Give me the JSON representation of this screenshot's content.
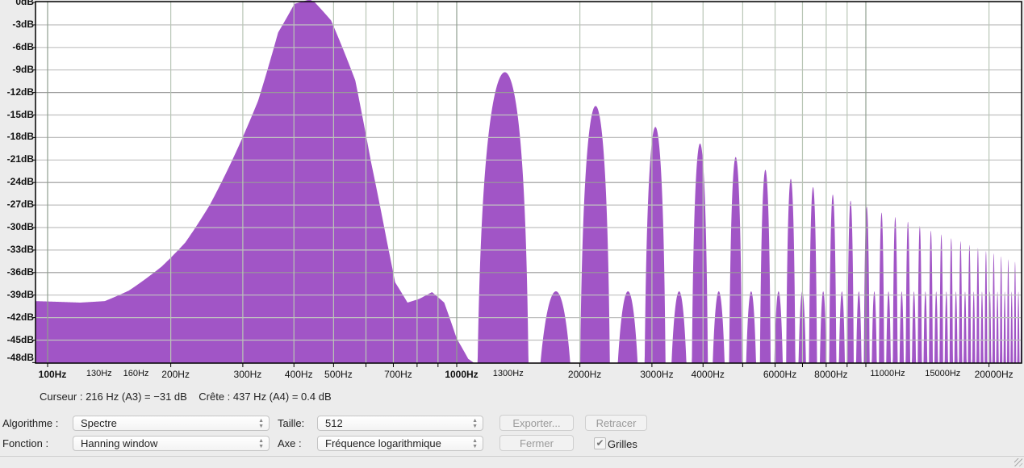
{
  "chart_data": {
    "type": "area",
    "title": "",
    "xlabel": "",
    "ylabel": "",
    "x_scale": "log",
    "xlim": [
      93,
      24000
    ],
    "ylim": [
      -48,
      0
    ],
    "grid": true,
    "fill_color": "#a155c6",
    "y_ticks": [
      {
        "v": 0,
        "label": "0dB"
      },
      {
        "v": -3,
        "label": "-3dB"
      },
      {
        "v": -6,
        "label": "-6dB"
      },
      {
        "v": -9,
        "label": "-9dB"
      },
      {
        "v": -12,
        "label": "-12dB"
      },
      {
        "v": -15,
        "label": "-15dB"
      },
      {
        "v": -18,
        "label": "-18dB"
      },
      {
        "v": -21,
        "label": "-21dB"
      },
      {
        "v": -24,
        "label": "-24dB"
      },
      {
        "v": -27,
        "label": "-27dB"
      },
      {
        "v": -30,
        "label": "-30dB"
      },
      {
        "v": -33,
        "label": "-33dB"
      },
      {
        "v": -36,
        "label": "-36dB"
      },
      {
        "v": -39,
        "label": "-39dB"
      },
      {
        "v": -42,
        "label": "-42dB"
      },
      {
        "v": -45,
        "label": "-45dB"
      },
      {
        "v": -48,
        "label": "-48dB"
      }
    ],
    "x_ticks": [
      {
        "v": 100,
        "label": "100Hz",
        "style": "major"
      },
      {
        "v": 130,
        "label": "130Hz",
        "style": "minor"
      },
      {
        "v": 160,
        "label": "160Hz",
        "style": "minor"
      },
      {
        "v": 200,
        "label": "200Hz",
        "style": "normal"
      },
      {
        "v": 300,
        "label": "300Hz",
        "style": "normal"
      },
      {
        "v": 400,
        "label": "400Hz",
        "style": "normal"
      },
      {
        "v": 500,
        "label": "500Hz",
        "style": "normal"
      },
      {
        "v": 700,
        "label": "700Hz",
        "style": "normal"
      },
      {
        "v": 1000,
        "label": "1000Hz",
        "style": "major"
      },
      {
        "v": 1300,
        "label": "1300Hz",
        "style": "minor"
      },
      {
        "v": 2000,
        "label": "2000Hz",
        "style": "normal"
      },
      {
        "v": 3000,
        "label": "3000Hz",
        "style": "normal"
      },
      {
        "v": 4000,
        "label": "4000Hz",
        "style": "normal"
      },
      {
        "v": 6000,
        "label": "6000Hz",
        "style": "normal"
      },
      {
        "v": 8000,
        "label": "8000Hz",
        "style": "normal"
      },
      {
        "v": 11000,
        "label": "11000Hz",
        "style": "minor"
      },
      {
        "v": 15000,
        "label": "15000Hz",
        "style": "minor"
      },
      {
        "v": 20000,
        "label": "20000Hz",
        "style": "normal"
      }
    ],
    "grid_freqs": [
      100,
      200,
      300,
      400,
      500,
      600,
      700,
      800,
      900,
      1000,
      2000,
      3000,
      4000,
      5000,
      6000,
      7000,
      8000,
      9000,
      10000,
      20000
    ],
    "fundamental_hz": 437,
    "main_lobe": [
      [
        93,
        -39.8
      ],
      [
        120,
        -40
      ],
      [
        138,
        -39.8
      ],
      [
        158,
        -38.4
      ],
      [
        190,
        -35.2
      ],
      [
        217,
        -32
      ],
      [
        249,
        -27
      ],
      [
        285,
        -20.6
      ],
      [
        327,
        -13.1
      ],
      [
        366,
        -4
      ],
      [
        401,
        -0.2
      ],
      [
        437,
        0.4
      ],
      [
        450,
        0
      ],
      [
        493,
        -2.4
      ],
      [
        565,
        -10.4
      ],
      [
        617,
        -21.2
      ],
      [
        676,
        -32
      ],
      [
        707,
        -37.3
      ],
      [
        758,
        -40
      ],
      [
        810,
        -39.5
      ],
      [
        870,
        -38.6
      ],
      [
        932,
        -40
      ],
      [
        1000,
        -44.8
      ],
      [
        1067,
        -47.5
      ],
      [
        1100,
        -48
      ]
    ],
    "odd_harmonics_db": [
      [
        3,
        -9.3
      ],
      [
        5,
        -13.8
      ],
      [
        7,
        -16.6
      ],
      [
        9,
        -18.8
      ],
      [
        11,
        -20.6
      ],
      [
        13,
        -22.3
      ],
      [
        15,
        -23.5
      ],
      [
        17,
        -24.6
      ],
      [
        19,
        -25.6
      ],
      [
        21,
        -26.4
      ],
      [
        23,
        -27.2
      ],
      [
        25,
        -28.0
      ],
      [
        27,
        -28.6
      ],
      [
        29,
        -29.2
      ],
      [
        31,
        -29.8
      ],
      [
        33,
        -30.4
      ],
      [
        35,
        -30.9
      ],
      [
        37,
        -31.4
      ],
      [
        39,
        -31.8
      ],
      [
        41,
        -32.3
      ],
      [
        43,
        -32.7
      ],
      [
        45,
        -33.1
      ],
      [
        47,
        -33.4
      ],
      [
        49,
        -33.8
      ],
      [
        51,
        -34.2
      ],
      [
        53,
        -34.5
      ],
      [
        55,
        -34.8
      ]
    ],
    "even_bump_db": -38.5
  },
  "status": "Curseur : 216 Hz (A3) = −31 dB    Crête : 437 Hz (A4) = 0.4 dB",
  "controls": {
    "algorithm_label": "Algorithme :",
    "algorithm_value": "Spectre",
    "function_label": "Fonction :",
    "function_value": "Hanning window",
    "size_label": "Taille:",
    "size_value": "512",
    "axis_label": "Axe :",
    "axis_value": "Fréquence logarithmique",
    "export_button": "Exporter...",
    "redraw_button": "Retracer",
    "close_button": "Fermer",
    "grids_label": "Grilles",
    "grids_checked": true,
    "check_mark": "✔",
    "arrows": "▲▼"
  }
}
